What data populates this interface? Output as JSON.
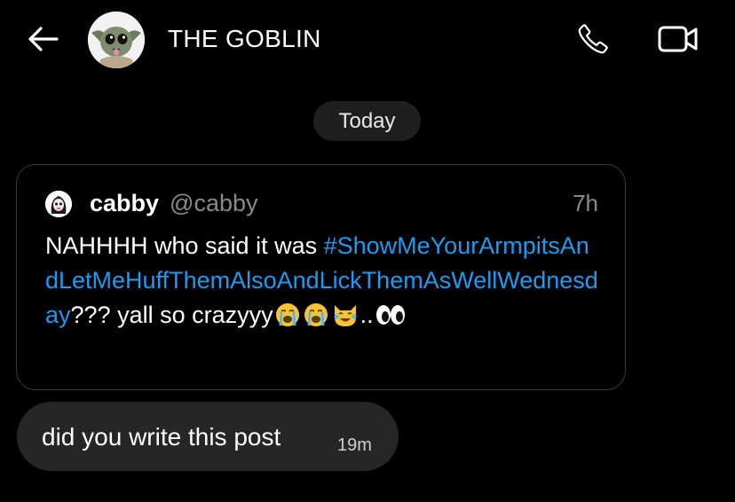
{
  "header": {
    "back_icon": "arrow-left-icon",
    "contact_name": "THE GOBLIN",
    "call_icon": "phone-icon",
    "video_icon": "video-camera-icon"
  },
  "date_separator": "Today",
  "shared_post": {
    "author_name": "cabby",
    "author_handle": "@cabby",
    "time_ago": "7h",
    "text_before": "NAHHHH who said it was ",
    "hashtag": "#ShowMeYourArmpitsAndLetMeHuffThemAlsoAndLickThemAsWellWednesday",
    "text_after": "??? yall so crazyyy",
    "trailing_text": "..",
    "emojis": [
      "loudly-crying-face",
      "loudly-crying-face",
      "cat-with-tears-of-joy",
      "eyes"
    ]
  },
  "message": {
    "text": "did you write this post",
    "time": "19m"
  },
  "colors": {
    "background": "#000000",
    "bubble": "#262626",
    "pill": "#1f1f1f",
    "link": "#1d9bf0",
    "muted": "#8a8a8a"
  }
}
